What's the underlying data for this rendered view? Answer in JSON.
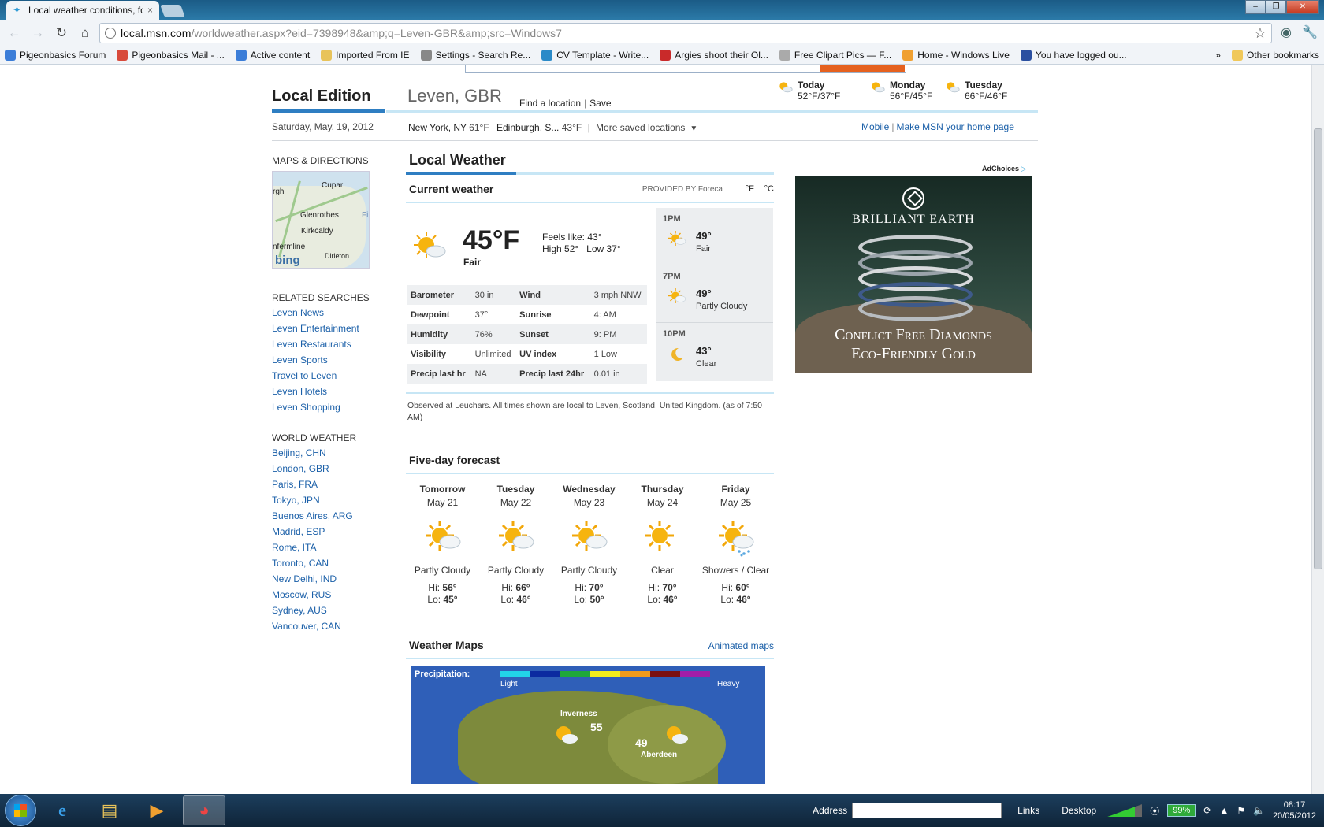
{
  "browser": {
    "tab_title": "Local weather conditions, fo",
    "tab_close": "×",
    "url_host": "local.msn.com",
    "url_path": "/worldweather.aspx?eid=7398948&amp;q=Leven-GBR&amp;src=Windows7",
    "bookmarks": [
      "Pigeonbasics Forum",
      "Pigeonbasics Mail - ...",
      "Active content",
      "Imported From IE",
      "Settings - Search Re...",
      "CV Template - Write...",
      "Argies shoot their Ol...",
      "Free Clipart Pics — F...",
      "Home - Windows Live",
      "You have logged ou..."
    ],
    "bookmarks_more": "»",
    "other_bookmarks": "Other bookmarks"
  },
  "header": {
    "edition": "Local Edition",
    "location": "Leven, GBR",
    "find_location": "Find a location",
    "save": "Save",
    "date": "Saturday, May. 19, 2012",
    "saved": [
      {
        "name": "New York, NY",
        "temp": "61°F"
      },
      {
        "name": "Edinburgh, S...",
        "temp": "43°F"
      }
    ],
    "more_saved": "More saved locations",
    "mobile": "Mobile",
    "make_home": "Make MSN your home page",
    "mini_forecast": [
      {
        "day": "Today",
        "temps": "52°F/37°F"
      },
      {
        "day": "Monday",
        "temps": "56°F/45°F"
      },
      {
        "day": "Tuesday",
        "temps": "66°F/46°F"
      }
    ]
  },
  "left": {
    "maps_title": "MAPS & DIRECTIONS",
    "map_labels": [
      "Cupar",
      "rgh",
      "Glenrothes",
      "Kirkcaldy",
      "nfermline",
      "Dirleton",
      "Fi"
    ],
    "map_brand": "bing",
    "related_title": "RELATED SEARCHES",
    "related": [
      "Leven News",
      "Leven Entertainment",
      "Leven Restaurants",
      "Leven Sports",
      "Travel to Leven",
      "Leven Hotels",
      "Leven Shopping"
    ],
    "world_title": "WORLD WEATHER",
    "world": [
      "Beijing, CHN",
      "London, GBR",
      "Paris, FRA",
      "Tokyo, JPN",
      "Buenos Aires, ARG",
      "Madrid, ESP",
      "Rome, ITA",
      "Toronto, CAN",
      "New Delhi, IND",
      "Moscow, RUS",
      "Sydney, AUS",
      "Vancouver, CAN"
    ]
  },
  "weather": {
    "title": "Local Weather",
    "current_title": "Current weather",
    "provided_by": "PROVIDED BY Foreca",
    "unit_f": "°F",
    "unit_c": "°C",
    "temp": "45°F",
    "condition": "Fair",
    "feels_like": "Feels like: 43°",
    "high_low": "High 52°   Low 37°",
    "details": [
      [
        "Barometer",
        "30 in",
        "Wind",
        "3 mph NNW"
      ],
      [
        "Dewpoint",
        "37°",
        "Sunrise",
        "4: AM"
      ],
      [
        "Humidity",
        "76%",
        "Sunset",
        "9: PM"
      ],
      [
        "Visibility",
        "Unlimited",
        "UV index",
        "1 Low"
      ],
      [
        "Precip last hr",
        "NA",
        "Precip last 24hr",
        "0.01 in"
      ]
    ],
    "hourly": [
      {
        "time": "1PM",
        "temp": "49°",
        "cond": "Fair",
        "icon": "sun-cloud-icon"
      },
      {
        "time": "7PM",
        "temp": "49°",
        "cond": "Partly Cloudy",
        "icon": "sun-cloud-icon"
      },
      {
        "time": "10PM",
        "temp": "43°",
        "cond": "Clear",
        "icon": "moon-icon"
      }
    ],
    "observed": "Observed at Leuchars. All times shown are local to Leven, Scotland, United Kingdom. (as of 7:50 AM)",
    "five_title": "Five-day forecast",
    "five_day": [
      {
        "day": "Tomorrow",
        "date": "May 21",
        "cond": "Partly Cloudy",
        "hi": "56°",
        "lo": "45°",
        "icon": "sun-cloud-icon"
      },
      {
        "day": "Tuesday",
        "date": "May 22",
        "cond": "Partly Cloudy",
        "hi": "66°",
        "lo": "46°",
        "icon": "sun-cloud-icon"
      },
      {
        "day": "Wednesday",
        "date": "May 23",
        "cond": "Partly Cloudy",
        "hi": "70°",
        "lo": "50°",
        "icon": "sun-cloud-icon"
      },
      {
        "day": "Thursday",
        "date": "May 24",
        "cond": "Clear",
        "hi": "70°",
        "lo": "46°",
        "icon": "sun-icon"
      },
      {
        "day": "Friday",
        "date": "May 25",
        "cond": "Showers / Clear",
        "hi": "60°",
        "lo": "46°",
        "icon": "sun-rain-icon"
      }
    ],
    "hi_label": "Hi:",
    "lo_label": "Lo:",
    "maps_title": "Weather Maps",
    "animated_maps": "Animated maps",
    "precip_label": "Precipitation:",
    "precip_light": "Light",
    "precip_heavy": "Heavy",
    "precip_colors": [
      "#22d3e8",
      "#0b2aa0",
      "#1fa83a",
      "#f2ee1a",
      "#f09a1a",
      "#7a1010",
      "#a21ca8"
    ],
    "map_cities": [
      {
        "name": "Inverness",
        "temp": "55"
      },
      {
        "name": "Aberdeen",
        "temp": "49"
      }
    ]
  },
  "ad": {
    "adchoices": "AdChoices",
    "brand": "BRILLIANT EARTH",
    "line1": "Conflict Free Diamonds",
    "line2": "Eco-Friendly Gold"
  },
  "taskbar": {
    "address_label": "Address",
    "links": "Links",
    "desktop": "Desktop",
    "battery": "99%",
    "time": "08:17",
    "date": "20/05/2012"
  }
}
